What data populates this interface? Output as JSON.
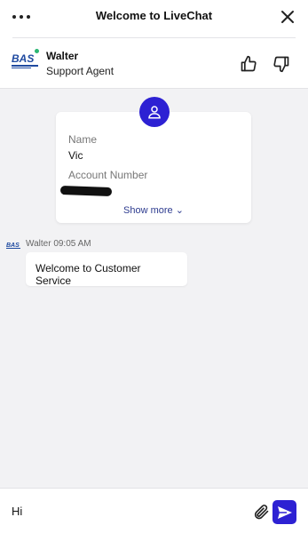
{
  "header": {
    "title": "Welcome to LiveChat",
    "menu_icon": "more-horizontal-icon",
    "close_icon": "close-icon"
  },
  "agent": {
    "name": "Walter",
    "role": "Support Agent",
    "logo_text": "BAS",
    "status_color": "#2bb673"
  },
  "feedback": {
    "thumbs_up_icon": "thumbs-up-icon",
    "thumbs_down_icon": "thumbs-down-icon"
  },
  "info_card": {
    "name_label": "Name",
    "name_value": "Vic",
    "account_label": "Account Number",
    "show_more": "Show more ⌄"
  },
  "messages": [
    {
      "sender": "Walter",
      "time": "09:05 AM",
      "text": "Welcome to Customer Service"
    }
  ],
  "composer": {
    "value": "Hi",
    "attach_icon": "paperclip-icon",
    "send_icon": "send-icon"
  },
  "colors": {
    "accent": "#2d21d3",
    "background": "#f2f2f4",
    "logo_blue": "#1f4aa0"
  }
}
